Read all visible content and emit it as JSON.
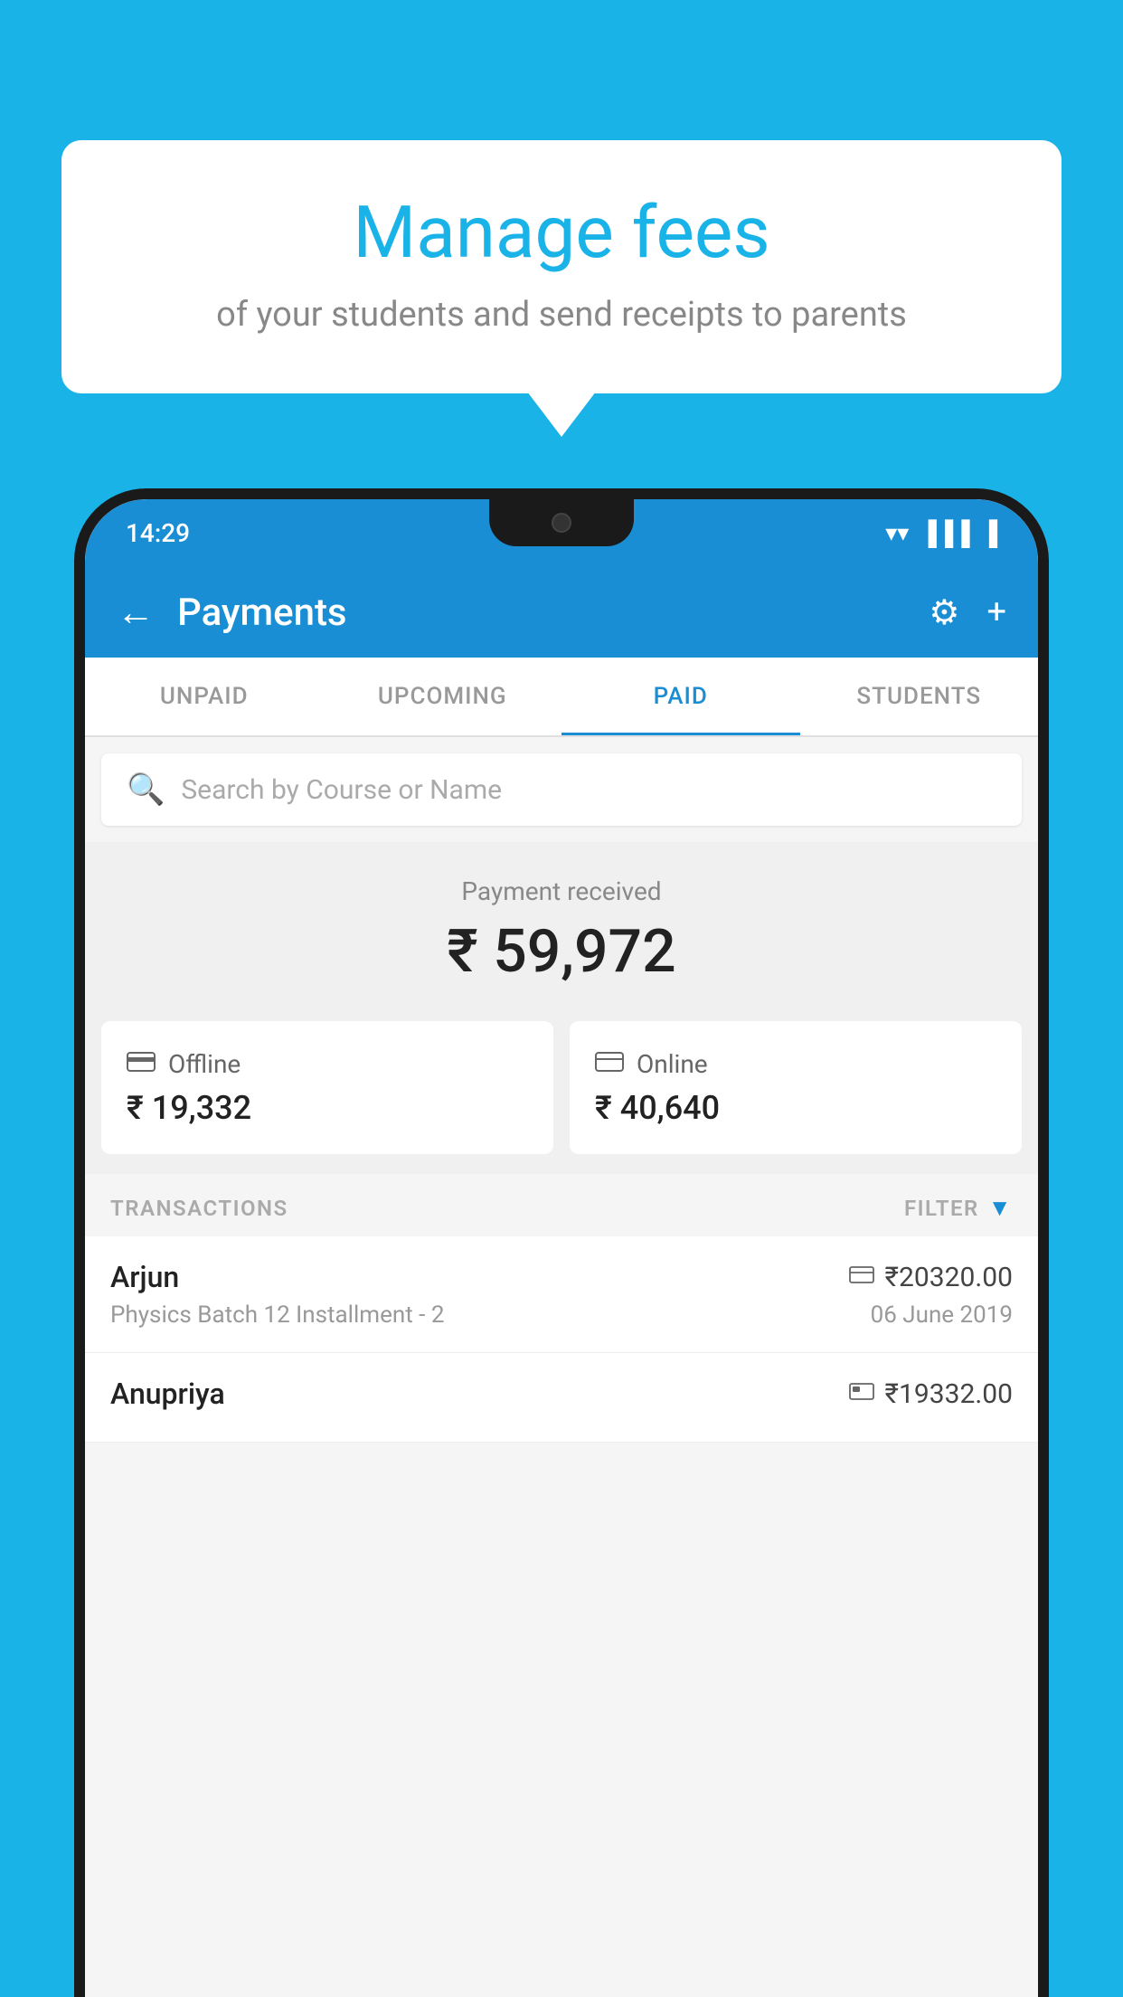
{
  "bubble": {
    "title": "Manage fees",
    "subtitle": "of your students and send receipts to parents"
  },
  "status_bar": {
    "time": "14:29"
  },
  "app_bar": {
    "title": "Payments",
    "back_icon": "←",
    "gear_icon": "⚙",
    "plus_icon": "+"
  },
  "tabs": [
    {
      "label": "UNPAID",
      "active": false
    },
    {
      "label": "UPCOMING",
      "active": false
    },
    {
      "label": "PAID",
      "active": true
    },
    {
      "label": "STUDENTS",
      "active": false
    }
  ],
  "search": {
    "placeholder": "Search by Course or Name"
  },
  "payment_summary": {
    "label": "Payment received",
    "amount": "₹ 59,972"
  },
  "cards": [
    {
      "icon": "💳",
      "label": "Offline",
      "amount": "₹ 19,332"
    },
    {
      "icon": "💳",
      "label": "Online",
      "amount": "₹ 40,640"
    }
  ],
  "transactions_header": {
    "label": "TRANSACTIONS",
    "filter_label": "FILTER"
  },
  "transactions": [
    {
      "name": "Arjun",
      "amount": "₹20320.00",
      "description": "Physics Batch 12 Installment - 2",
      "date": "06 June 2019",
      "icon": "💳"
    },
    {
      "name": "Anupriya",
      "amount": "₹19332.00",
      "description": "",
      "date": "",
      "icon": "💴"
    }
  ]
}
